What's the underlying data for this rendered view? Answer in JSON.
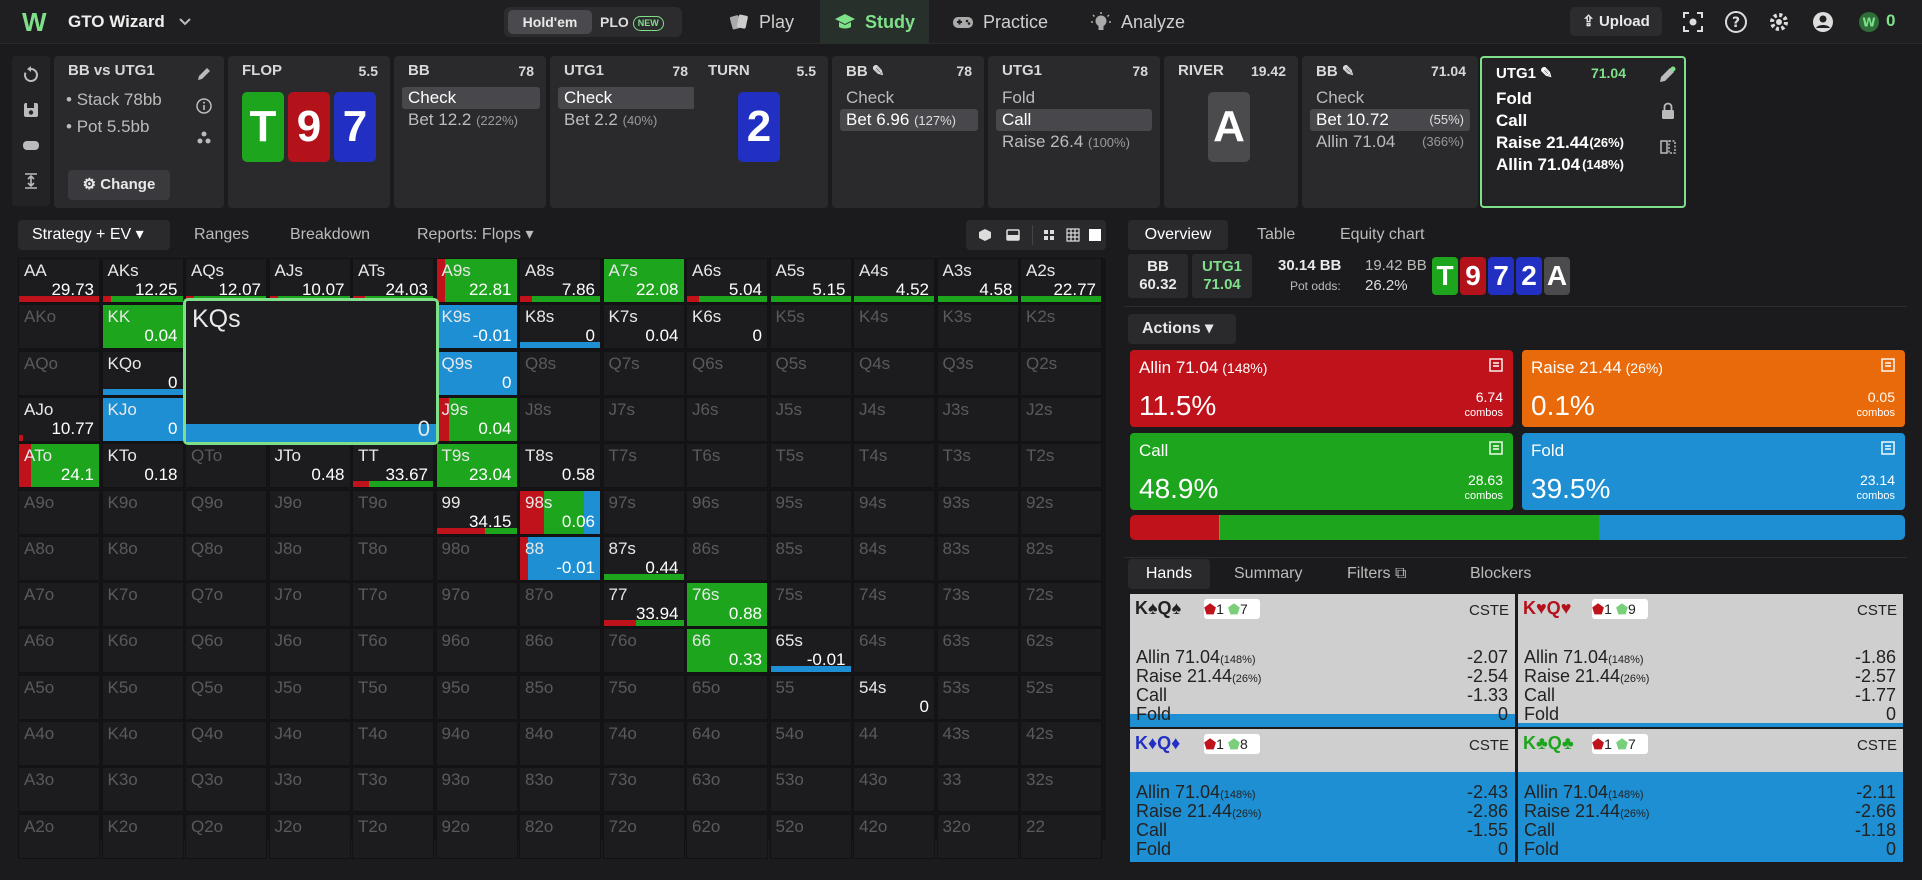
{
  "app": {
    "brand": "GTO Wizard",
    "hold_em": "Hold'em",
    "plo": "PLO",
    "plo_badge": "NEW",
    "upload": "Upload",
    "nav": [
      "Play",
      "Study",
      "Practice",
      "Analyze"
    ],
    "accent": "#7fe08a"
  },
  "strip": {
    "player": "BB vs UTG1",
    "stack_label": "Stack 78bb",
    "pot_label": "Pot 5.5bb",
    "change": "Change",
    "flop": {
      "title": "FLOP",
      "pot": "5.5",
      "cards": [
        "T",
        "9",
        "7"
      ]
    },
    "bb1": {
      "title": "BB",
      "stack": "78",
      "actions": [
        {
          "label": "Check",
          "pct": ""
        },
        {
          "label": "Bet 12.2",
          "pct": "(222%)"
        }
      ]
    },
    "utg1": {
      "title": "UTG1",
      "stack": "78",
      "actions": [
        {
          "label": "Check",
          "pct": ""
        },
        {
          "label": "Bet 2.2",
          "pct": "(40%)"
        }
      ]
    },
    "turn": {
      "title": "TURN",
      "pot": "5.5",
      "card": "2"
    },
    "bb2": {
      "title": "BB",
      "stack": "78",
      "actions": [
        {
          "label": "Check",
          "pct": ""
        },
        {
          "label": "Bet 6.96",
          "pct": "(127%)"
        }
      ]
    },
    "utg2": {
      "title": "UTG1",
      "stack": "78",
      "actions": [
        {
          "label": "Fold",
          "pct": ""
        },
        {
          "label": "Call",
          "pct": ""
        },
        {
          "label": "Raise 26.4",
          "pct": "(100%)"
        }
      ]
    },
    "river": {
      "title": "RIVER",
      "pot": "19.42",
      "card": "A"
    },
    "bb3": {
      "title": "BB",
      "stack": "71.04",
      "actions": [
        {
          "label": "Check",
          "pct": ""
        },
        {
          "label": "Bet 10.72",
          "pct": "(55%)"
        },
        {
          "label": "Allin 71.04",
          "pct": "(366%)"
        }
      ]
    },
    "utg3": {
      "title": "UTG1",
      "stack": "71.04",
      "actions": [
        {
          "label": "Fold",
          "pct": ""
        },
        {
          "label": "Call",
          "pct": ""
        },
        {
          "label": "Raise 21.44",
          "pct": "(26%)"
        },
        {
          "label": "Allin 71.04",
          "pct": "(148%)"
        }
      ]
    }
  },
  "left_tabs": [
    "Strategy + EV",
    "Ranges",
    "Breakdown",
    "Reports: Flops"
  ],
  "grid": {
    "labels": [
      [
        "AA",
        "AKs",
        "AQs",
        "AJs",
        "ATs",
        "A9s",
        "A8s",
        "A7s",
        "A6s",
        "A5s",
        "A4s",
        "A3s",
        "A2s"
      ],
      [
        "AKo",
        "KK",
        "KQs",
        "KJs",
        "KTs",
        "K9s",
        "K8s",
        "K7s",
        "K6s",
        "K5s",
        "K4s",
        "K3s",
        "K2s"
      ],
      [
        "AQo",
        "KQo",
        "QQ",
        "QJs",
        "QTs",
        "Q9s",
        "Q8s",
        "Q7s",
        "Q6s",
        "Q5s",
        "Q4s",
        "Q3s",
        "Q2s"
      ],
      [
        "AJo",
        "KJo",
        "QJo",
        "JJ",
        "JTs",
        "J9s",
        "J8s",
        "J7s",
        "J6s",
        "J5s",
        "J4s",
        "J3s",
        "J2s"
      ],
      [
        "ATo",
        "KTo",
        "QTo",
        "JTo",
        "TT",
        "T9s",
        "T8s",
        "T7s",
        "T6s",
        "T5s",
        "T4s",
        "T3s",
        "T2s"
      ],
      [
        "A9o",
        "K9o",
        "Q9o",
        "J9o",
        "T9o",
        "99",
        "98s",
        "97s",
        "96s",
        "95s",
        "94s",
        "93s",
        "92s"
      ],
      [
        "A8o",
        "K8o",
        "Q8o",
        "J8o",
        "T8o",
        "98o",
        "88",
        "87s",
        "86s",
        "85s",
        "84s",
        "83s",
        "82s"
      ],
      [
        "A7o",
        "K7o",
        "Q7o",
        "J7o",
        "T7o",
        "97o",
        "87o",
        "77",
        "76s",
        "75s",
        "74s",
        "73s",
        "72s"
      ],
      [
        "A6o",
        "K6o",
        "Q6o",
        "J6o",
        "T6o",
        "96o",
        "86o",
        "76o",
        "66",
        "65s",
        "64s",
        "63s",
        "62s"
      ],
      [
        "A5o",
        "K5o",
        "Q5o",
        "J5o",
        "T5o",
        "95o",
        "85o",
        "75o",
        "65o",
        "55",
        "54s",
        "53s",
        "52s"
      ],
      [
        "A4o",
        "K4o",
        "Q4o",
        "J4o",
        "T4o",
        "94o",
        "84o",
        "74o",
        "64o",
        "54o",
        "44",
        "43s",
        "42s"
      ],
      [
        "A3o",
        "K3o",
        "Q3o",
        "J3o",
        "T3o",
        "93o",
        "83o",
        "73o",
        "63o",
        "53o",
        "43o",
        "33",
        "32s"
      ],
      [
        "A2o",
        "K2o",
        "Q2o",
        "J2o",
        "T2o",
        "92o",
        "82o",
        "72o",
        "62o",
        "52o",
        "42o",
        "32o",
        "22"
      ]
    ],
    "evs": {
      "AA": "29.73",
      "AKs": "12.25",
      "AQs": "12.07",
      "AJs": "10.07",
      "ATs": "24.03",
      "A9s": "22.81",
      "A8s": "7.86",
      "A7s": "22.08",
      "A6s": "5.04",
      "A5s": "5.15",
      "A4s": "4.52",
      "A3s": "4.58",
      "A2s": "22.77",
      "KK": "0.04",
      "K9s": "-0.01",
      "K8s": "0",
      "K7s": "0.04",
      "K6s": "0",
      "KQo": "0",
      "Q9s": "0",
      "AJo": "10.77",
      "KJo": "0",
      "J9s": "0.04",
      "ATo": "24.1",
      "KTo": "0.18",
      "JTo": "0.48",
      "TT": "33.67",
      "T9s": "23.04",
      "T8s": "0.58",
      "99": "34.15",
      "98s": "0.06",
      "88": "-0.01",
      "87s": "0.44",
      "77": "33.94",
      "76s": "0.88",
      "66": "0.33",
      "65s": "-0.01",
      "54s": "0"
    },
    "colors": {
      "allin": "#c0121b",
      "raise": "#e86a0a",
      "call": "#1da51d",
      "fold": "#1e8fd2"
    },
    "bars": {
      "AA": [
        [
          0.5,
          "allin"
        ],
        [
          0.5,
          "allin"
        ]
      ],
      "AKs": [
        [
          0.1,
          "allin"
        ],
        [
          0.9,
          "call"
        ]
      ],
      "AQs": [
        [
          0.1,
          "allin"
        ],
        [
          0.9,
          "call"
        ]
      ],
      "AJs": [
        [
          0.1,
          "allin"
        ],
        [
          0.9,
          "call"
        ]
      ],
      "ATs": [
        [
          0.15,
          "allin"
        ],
        [
          0.85,
          "call"
        ]
      ],
      "A9s": [
        [
          0.1,
          "allin"
        ],
        [
          0.9,
          "call"
        ]
      ],
      "A8s": [
        [
          0.15,
          "allin"
        ],
        [
          0.85,
          "call"
        ]
      ],
      "A7s": [
        [
          1,
          "call"
        ]
      ],
      "A6s": [
        [
          0.15,
          "allin"
        ],
        [
          0.85,
          "call"
        ]
      ],
      "A5s": [
        [
          1,
          "call"
        ]
      ],
      "A4s": [
        [
          1,
          "call"
        ]
      ],
      "A3s": [
        [
          1,
          "call"
        ]
      ],
      "A2s": [
        [
          1,
          "call"
        ]
      ],
      "KK": [
        [
          1,
          "call"
        ]
      ],
      "KQs": [
        [
          1,
          "fold"
        ]
      ],
      "K9s": [
        [
          1,
          "fold"
        ]
      ],
      "K8s": [
        [
          1,
          "fold"
        ]
      ],
      "KQo": [
        [
          1,
          "fold"
        ]
      ],
      "Q9s": [
        [
          1,
          "fold"
        ]
      ],
      "AJo": [
        [
          0.05,
          "allin"
        ]
      ],
      "KJo": [
        [
          1,
          "fold"
        ]
      ],
      "J9s": [
        [
          0.15,
          "allin"
        ],
        [
          0.85,
          "call"
        ]
      ],
      "ATo": [
        [
          0.15,
          "allin"
        ],
        [
          0.85,
          "call"
        ]
      ],
      "TT": [
        [
          0.2,
          "allin"
        ],
        [
          0.8,
          "call"
        ]
      ],
      "T9s": [
        [
          1,
          "call"
        ]
      ],
      "99": [
        [
          0.6,
          "allin"
        ],
        [
          0.4,
          "call"
        ]
      ],
      "98s": [
        [
          0.3,
          "allin"
        ],
        [
          0.5,
          "call"
        ],
        [
          0.2,
          "fold"
        ]
      ],
      "88": [
        [
          0.1,
          "allin"
        ],
        [
          0.9,
          "fold"
        ]
      ],
      "87s": [
        [
          1,
          "call"
        ]
      ],
      "77": [
        [
          0.4,
          "allin"
        ],
        [
          0.6,
          "call"
        ]
      ],
      "76s": [
        [
          1,
          "call"
        ]
      ],
      "66": [
        [
          1,
          "call"
        ]
      ],
      "65s": [
        [
          1,
          "fold"
        ]
      ]
    },
    "bar_full": {
      "A9s": 1,
      "A7s": 1,
      "KK": 1,
      "K9s": 1,
      "KQo": 0,
      "Q9s": 1,
      "KJo": 1,
      "J9s": 1,
      "ATo": 1,
      "T9s": 1,
      "98s": 1,
      "88": 1,
      "76s": 1,
      "66": 1
    },
    "dim": [
      "AKo",
      "K5s",
      "K4s",
      "K3s",
      "K2s",
      "AQo",
      "Q8s",
      "Q7s",
      "Q6s",
      "Q5s",
      "Q4s",
      "Q3s",
      "Q2s",
      "J8s",
      "J7s",
      "J6s",
      "J5s",
      "J4s",
      "J3s",
      "J2s",
      "QTo",
      "T7s",
      "T6s",
      "T5s",
      "T4s",
      "T3s",
      "T2s",
      "A9o",
      "K9o",
      "Q9o",
      "J9o",
      "T9o",
      "97s",
      "96s",
      "95s",
      "94s",
      "93s",
      "92s",
      "A8o",
      "K8o",
      "Q8o",
      "J8o",
      "T8o",
      "98o",
      "86s",
      "85s",
      "84s",
      "83s",
      "82s",
      "A7o",
      "K7o",
      "Q7o",
      "J7o",
      "T7o",
      "97o",
      "87o",
      "75s",
      "74s",
      "73s",
      "72s",
      "A6o",
      "K6o",
      "Q6o",
      "J6o",
      "T6o",
      "96o",
      "86o",
      "76o",
      "64s",
      "63s",
      "62s",
      "A5o",
      "K5o",
      "Q5o",
      "J5o",
      "T5o",
      "95o",
      "85o",
      "75o",
      "65o",
      "55",
      "53s",
      "52s",
      "A4o",
      "K4o",
      "Q4o",
      "J4o",
      "T4o",
      "94o",
      "84o",
      "74o",
      "64o",
      "54o",
      "44",
      "43s",
      "42s",
      "A3o",
      "K3o",
      "Q3o",
      "J3o",
      "T3o",
      "93o",
      "83o",
      "73o",
      "63o",
      "53o",
      "43o",
      "33",
      "32s",
      "A2o",
      "K2o",
      "Q2o",
      "J2o",
      "T2o",
      "92o",
      "82o",
      "72o",
      "62o",
      "52o",
      "42o",
      "32o",
      "22"
    ],
    "zoom": {
      "hand": "KQs",
      "ev": "0"
    }
  },
  "right_tabs": [
    "Overview",
    "Table",
    "Equity chart"
  ],
  "summary": {
    "bb": "BB",
    "bb_stack": "60.32",
    "utg": "UTG1",
    "utg_stack": "71.04",
    "pot": "30.14 BB",
    "pot2": "19.42 BB",
    "pot_odds_label": "Pot odds:",
    "pot_odds": "26.2%",
    "board": [
      "T",
      "9",
      "7",
      "2",
      "A"
    ]
  },
  "actions_label": "Actions",
  "actions": [
    {
      "label": "Allin 71.04",
      "pct": "(148%)",
      "freq": "11.5%",
      "combos": "6.74",
      "color": "#c0121b"
    },
    {
      "label": "Raise 21.44",
      "pct": "(26%)",
      "freq": "0.1%",
      "combos": "0.05",
      "color": "#e86a0a"
    },
    {
      "label": "Call",
      "pct": "",
      "freq": "48.9%",
      "combos": "28.63",
      "color": "#1da51d"
    },
    {
      "label": "Fold",
      "pct": "",
      "freq": "39.5%",
      "combos": "23.14",
      "color": "#1e8fd2"
    }
  ],
  "combos_word": "combos",
  "freq_bar": [
    0.115,
    0.001,
    0.489,
    0.395
  ],
  "hand_tabs": [
    "Hands",
    "Summary",
    "Filters",
    "Blockers"
  ],
  "hands": [
    {
      "cards": "K♠Q♠",
      "card_color": "#222",
      "b1": "1",
      "b2": "7",
      "cste": "CSTE",
      "rows": [
        [
          "Allin 71.04",
          "(148%)",
          "-2.07"
        ],
        [
          "Raise 21.44",
          "(26%)",
          "-2.54"
        ],
        [
          "Call",
          "",
          "-1.33"
        ],
        [
          "Fold",
          "",
          "0"
        ]
      ],
      "fold_frac": 0.1
    },
    {
      "cards": "K♥Q♥",
      "card_color": "#b3121a",
      "b1": "1",
      "b2": "9",
      "cste": "CSTE",
      "rows": [
        [
          "Allin 71.04",
          "(148%)",
          "-1.86"
        ],
        [
          "Raise 21.44",
          "(26%)",
          "-2.57"
        ],
        [
          "Call",
          "",
          "-1.77"
        ],
        [
          "Fold",
          "",
          "0"
        ]
      ],
      "fold_frac": 0.03
    },
    {
      "cards": "K♦Q♦",
      "card_color": "#2130c2",
      "b1": "1",
      "b2": "8",
      "cste": "CSTE",
      "rows": [
        [
          "Allin 71.04",
          "(148%)",
          "-2.43"
        ],
        [
          "Raise 21.44",
          "(26%)",
          "-2.86"
        ],
        [
          "Call",
          "",
          "-1.55"
        ],
        [
          "Fold",
          "",
          "0"
        ]
      ],
      "fold_frac": 0.68
    },
    {
      "cards": "K♣Q♣",
      "card_color": "#1da51d",
      "b1": "1",
      "b2": "7",
      "cste": "CSTE",
      "rows": [
        [
          "Allin 71.04",
          "(148%)",
          "-2.11"
        ],
        [
          "Raise 21.44",
          "(26%)",
          "-2.66"
        ],
        [
          "Call",
          "",
          "-1.18"
        ],
        [
          "Fold",
          "",
          "0"
        ]
      ],
      "fold_frac": 0.68
    }
  ]
}
